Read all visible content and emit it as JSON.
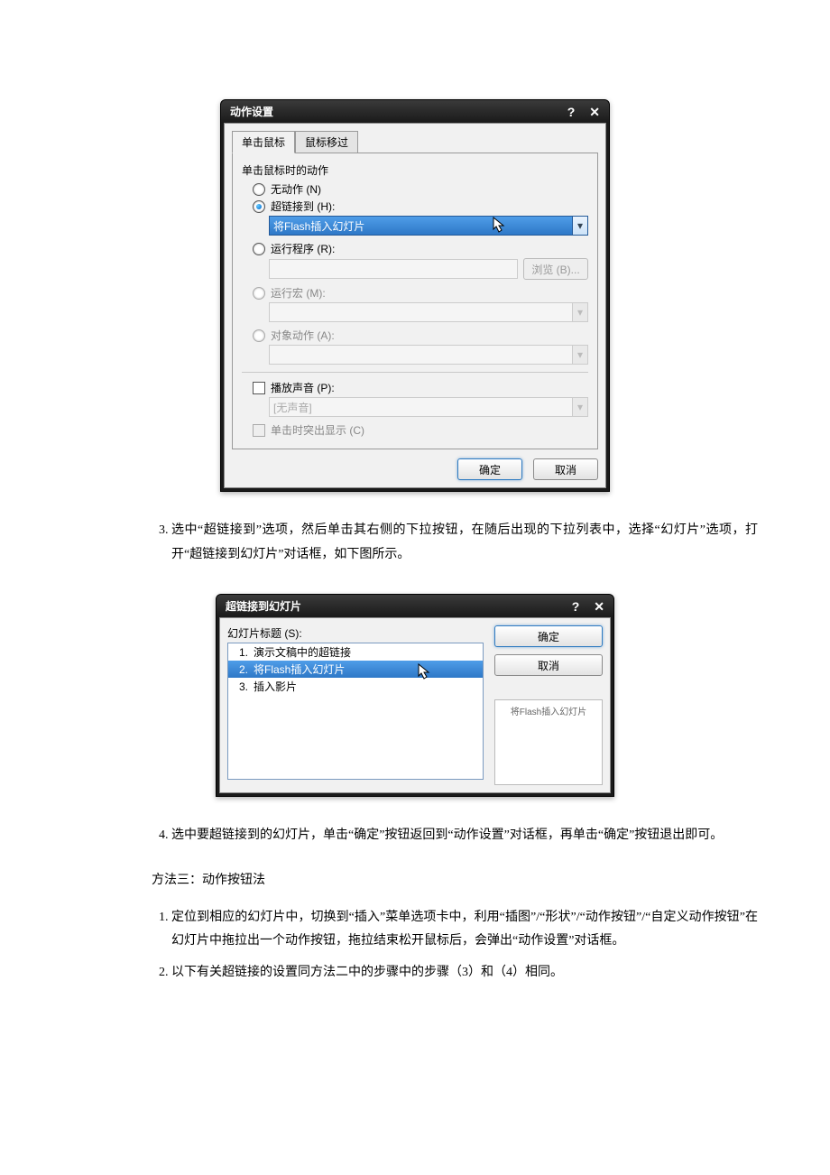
{
  "dialog1": {
    "title": "动作设置",
    "tabs": {
      "click": "单击鼠标",
      "hover": "鼠标移过"
    },
    "group_label": "单击鼠标时的动作",
    "radios": {
      "none": "无动作 (N)",
      "hyperlink": "超链接到 (H):",
      "run_prog": "运行程序 (R):",
      "run_macro": "运行宏 (M):",
      "obj_action": "对象动作 (A):"
    },
    "hyperlink_value": "将Flash插入幻灯片",
    "browse_btn": "浏览 (B)...",
    "play_sound": "播放声音 (P):",
    "sound_value": "[无声音]",
    "highlight": "单击时突出显示 (C)",
    "ok": "确定",
    "cancel": "取消"
  },
  "dialog2": {
    "title": "超链接到幻灯片",
    "list_label": "幻灯片标题 (S):",
    "items": [
      {
        "n": "1.",
        "label": "演示文稿中的超链接"
      },
      {
        "n": "2.",
        "label": "将Flash插入幻灯片"
      },
      {
        "n": "3.",
        "label": "插入影片"
      }
    ],
    "preview_caption": "将Flash插入幻灯片",
    "ok": "确定",
    "cancel": "取消"
  },
  "doc": {
    "step3": "选中“超链接到”选项，然后单击其右侧的下拉按钮，在随后出现的下拉列表中，选择“幻灯片”选项，打开“超链接到幻灯片”对话框，如下图所示。",
    "step4": "选中要超链接到的幻灯片，单击“确定”按钮返回到“动作设置”对话框，再单击“确定”按钮退出即可。",
    "method3_label": "方法三：动作按钮法",
    "m3_step1": "定位到相应的幻灯片中，切换到“插入”菜单选项卡中，利用“插图”/“形状”/“动作按钮”/“自定义动作按钮”在幻灯片中拖拉出一个动作按钮，拖拉结束松开鼠标后，会弹出“动作设置”对话框。",
    "m3_step2": "以下有关超链接的设置同方法二中的步骤中的步骤（3）和（4）相同。"
  }
}
